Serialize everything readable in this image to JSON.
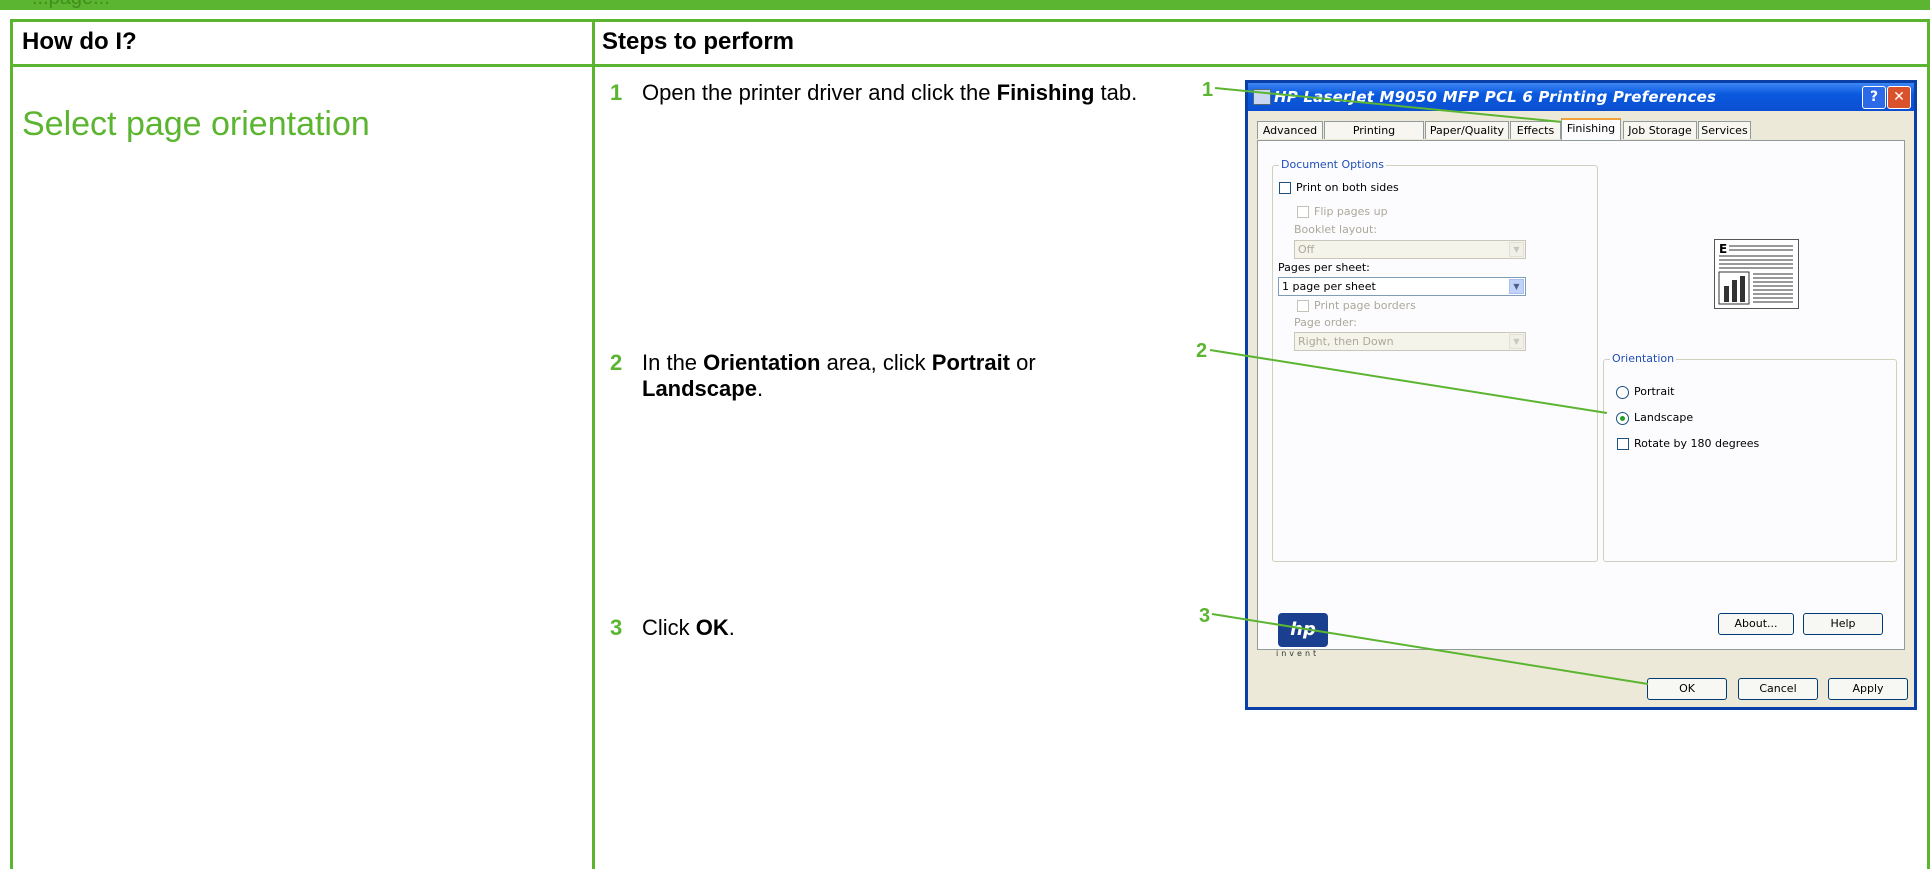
{
  "banner": {
    "text": "...page..."
  },
  "table": {
    "header_left": "How do I?",
    "header_right": "Steps to perform"
  },
  "task": {
    "title": "Select page orientation"
  },
  "steps": [
    {
      "num": "1",
      "pre": "Open the printer driver and click the ",
      "bold": "Finishing",
      "post": " tab."
    },
    {
      "num": "2",
      "pre": "In the ",
      "bold": "Orientation",
      "mid": " area, click ",
      "bold2": "Portrait",
      "post": " or",
      "bold3": "Landscape",
      "post2": "."
    },
    {
      "num": "3",
      "pre": "Click ",
      "bold": "OK",
      "post": "."
    }
  ],
  "callouts": [
    "1",
    "2",
    "3"
  ],
  "dialog": {
    "title": "HP LaserJet M9050 MFP PCL 6 Printing Preferences",
    "help_glyph": "?",
    "close_glyph": "✕",
    "tabs": [
      "Advanced",
      "Printing Shortcuts",
      "Paper/Quality",
      "Effects",
      "Finishing",
      "Job Storage",
      "Services"
    ],
    "active_tab": "Finishing",
    "document_options": {
      "label": "Document Options",
      "print_both_sides": "Print on both sides",
      "flip_pages_up": "Flip pages up",
      "booklet_layout": "Booklet layout:",
      "booklet_value": "Off",
      "pages_per_sheet": "Pages per sheet:",
      "pages_per_sheet_value": "1 page per sheet",
      "print_page_borders": "Print page borders",
      "page_order": "Page order:",
      "page_order_value": "Right, then Down"
    },
    "orientation": {
      "label": "Orientation",
      "portrait": "Portrait",
      "landscape": "Landscape",
      "rotate": "Rotate by 180 degrees",
      "selected": "Landscape"
    },
    "logo": {
      "mark": "hp",
      "tagline": "invent"
    },
    "buttons": {
      "about": "About...",
      "help": "Help",
      "ok": "OK",
      "cancel": "Cancel",
      "apply": "Apply"
    }
  },
  "colors": {
    "accent": "#5cb531",
    "titlebar": "#0a59df"
  }
}
